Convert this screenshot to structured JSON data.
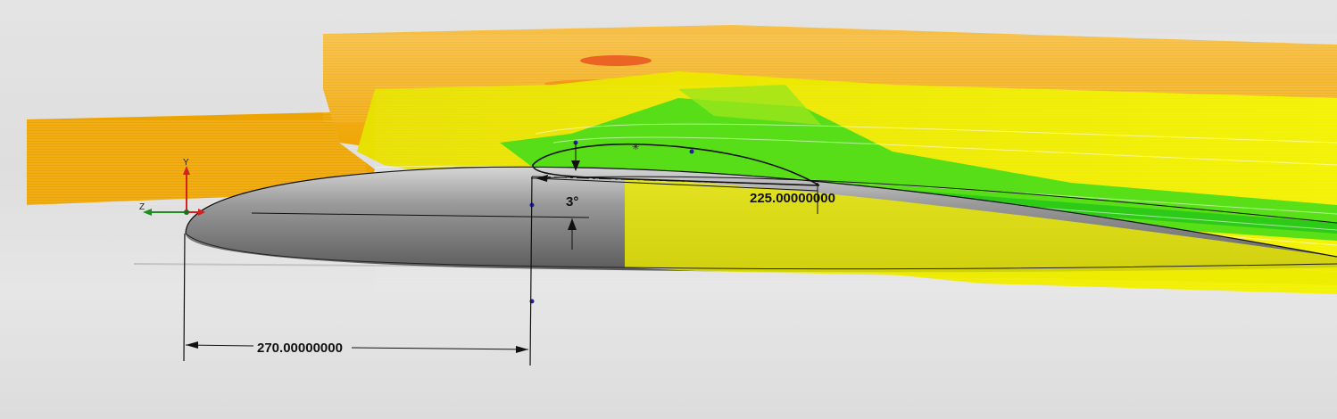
{
  "viewport": {
    "scene": "flow-simulation-over-airfoil"
  },
  "dimensions": {
    "horizontal_distance": "270.00000000",
    "chord_length": "225.00000000",
    "angle": "3°"
  },
  "triad": {
    "y_label": "Y",
    "z_label": "Z"
  },
  "colors": {
    "orange": "#f2a800",
    "yellow": "#f5f000",
    "green": "#3ddc1a",
    "red": "#e8541e",
    "body_gray": "#8a8a8a",
    "x_axis": "#d42020",
    "y_axis": "#d42020",
    "z_axis": "#1e8e1e"
  }
}
